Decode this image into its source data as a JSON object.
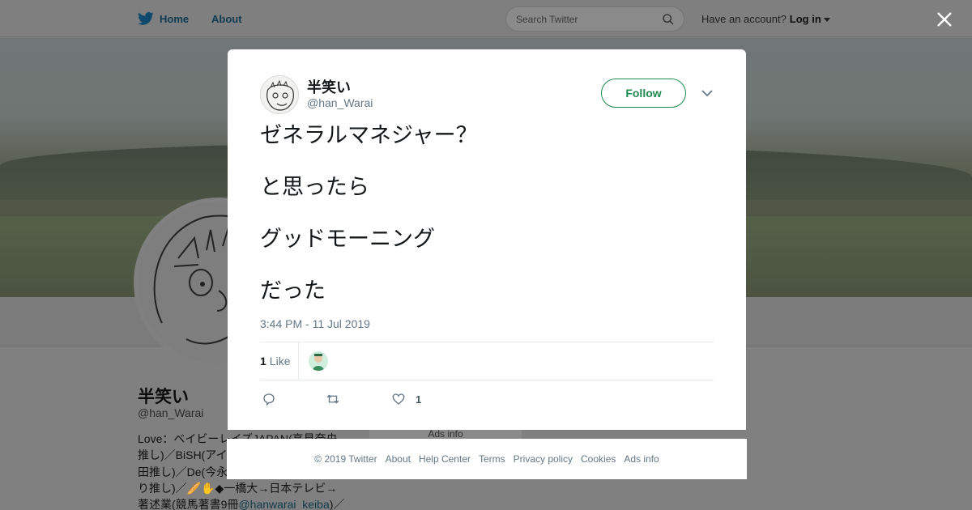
{
  "topnav": {
    "home": "Home",
    "about": "About",
    "search_placeholder": "Search Twitter",
    "account_prompt": "Have an account?",
    "login": "Log in"
  },
  "profile": {
    "name": "半笑い",
    "handle": "@han_Warai",
    "bio_lines": [
      "Love：ベイビーレイズJAPAN(高見奈央",
      "推し)／BiSH(アイ",
      "田推し)／De(今永",
      "り推し)／🥖✋◆一橋大→日本テレビ→",
      "著述業(競馬著書9冊"
    ],
    "bio_link": "@hanwarai_keiba",
    "bio_tail": ")／",
    "ads_info": "Ads info"
  },
  "tweet": {
    "author_name": "半笑い",
    "author_handle": "@han_Warai",
    "follow_label": "Follow",
    "lines": [
      "ゼネラルマネジャー？",
      "と思ったら",
      "グッドモーニング",
      "だった"
    ],
    "timestamp": "3:44 PM - 11 Jul 2019",
    "likes_count": "1",
    "likes_label": "Like",
    "like_action_count": "1"
  },
  "footer": {
    "copyright": "© 2019 Twitter",
    "about": "About",
    "help": "Help Center",
    "terms": "Terms",
    "privacy": "Privacy policy",
    "cookies": "Cookies",
    "ads": "Ads info"
  },
  "colors": {
    "accent": "#1da1f2",
    "follow_green": "#1f8a4f",
    "overlay_gray": "#808080",
    "muted_text": "#657786"
  }
}
